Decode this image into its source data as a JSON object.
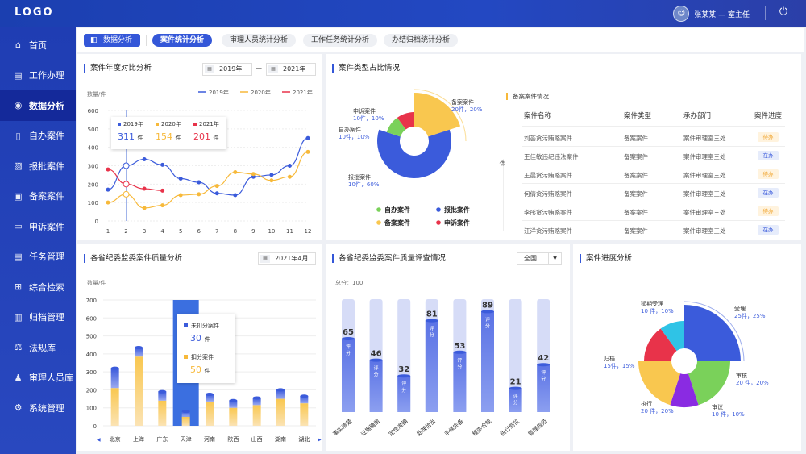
{
  "header": {
    "logo": "LOGO",
    "user_name": "张某某 — 室主任",
    "avatar_icon": "user-avatar"
  },
  "nav": [
    {
      "label": "首页",
      "icon": "home-icon",
      "glyph": "⌂"
    },
    {
      "label": "工作办理",
      "icon": "briefcase-icon",
      "glyph": "▤"
    },
    {
      "label": "数据分析",
      "icon": "chart-icon",
      "glyph": "◉",
      "active": true
    },
    {
      "label": "自办案件",
      "icon": "clipboard-icon",
      "glyph": "▯"
    },
    {
      "label": "报批案件",
      "icon": "document-icon",
      "glyph": "▧"
    },
    {
      "label": "备案案件",
      "icon": "person-card-icon",
      "glyph": "▣"
    },
    {
      "label": "申诉案件",
      "icon": "chat-icon",
      "glyph": "▭"
    },
    {
      "label": "任务管理",
      "icon": "list-icon",
      "glyph": "▤"
    },
    {
      "label": "综合检索",
      "icon": "grid-icon",
      "glyph": "⊞"
    },
    {
      "label": "归档管理",
      "icon": "archive-icon",
      "glyph": "▥"
    },
    {
      "label": "法规库",
      "icon": "scale-icon",
      "glyph": "⚖"
    },
    {
      "label": "审理人员库",
      "icon": "people-icon",
      "glyph": "♟"
    },
    {
      "label": "系统管理",
      "icon": "gear-icon",
      "glyph": "⚙"
    }
  ],
  "tabs": {
    "main": "数据分析",
    "items": [
      "案件统计分析",
      "审理人员统计分析",
      "工作任务统计分析",
      "办结归档统计分析"
    ]
  },
  "panel1": {
    "title": "案件年度对比分析",
    "from": "2019年",
    "dash": "—",
    "to": "2021年",
    "unit": "数量/件",
    "legend": [
      "2019年",
      "2020年",
      "2021年"
    ],
    "tooltip": {
      "items": [
        {
          "year": "2019年",
          "value": "311",
          "unit": "件"
        },
        {
          "year": "2020年",
          "value": "154",
          "unit": "件"
        },
        {
          "year": "2021年",
          "value": "201",
          "unit": "件"
        }
      ]
    },
    "colors": [
      "#3b5bdb",
      "#f7b93a",
      "#e8334a"
    ]
  },
  "panel2": {
    "title": "案件类型占比情况",
    "table_title": "备案案件情况",
    "headers": [
      "案件名称",
      "案件类型",
      "承办部门",
      "案件进度"
    ],
    "rows": [
      {
        "name": "刘荟贪污贿赂案件",
        "type": "备案案件",
        "dept": "案件审理室三处",
        "status": "待办"
      },
      {
        "name": "王佳敏违纪违法案件",
        "type": "备案案件",
        "dept": "案件审理室三处",
        "status": "在办"
      },
      {
        "name": "王晨贪污贿赂案件",
        "type": "备案案件",
        "dept": "案件审理室三处",
        "status": "待办"
      },
      {
        "name": "何倩贪污贿赂案件",
        "type": "备案案件",
        "dept": "案件审理室三处",
        "status": "在办"
      },
      {
        "name": "李彤贪污贿赂案件",
        "type": "备案案件",
        "dept": "案件审理室三处",
        "status": "待办"
      },
      {
        "name": "汪洋贪污贿赂案件",
        "type": "备案案件",
        "dept": "案件审理室三处",
        "status": "在办"
      }
    ],
    "legend": [
      "自办案件",
      "报批案件",
      "备案案件",
      "申诉案件"
    ],
    "labels": [
      {
        "name": "备案案件",
        "value": "20件，20%"
      },
      {
        "name": "申诉案件",
        "value": "10件，10%"
      },
      {
        "name": "自办案件",
        "value": "10件，10%"
      },
      {
        "name": "报批案件",
        "value": "10件，60%"
      }
    ]
  },
  "panel3": {
    "title": "各省纪委监委案件质量分析",
    "date": "2021年4月",
    "unit": "数量/件",
    "tooltip": {
      "a": "未扣分案件",
      "a_val": "30",
      "b": "扣分案件",
      "b_val": "50",
      "unit": "件"
    }
  },
  "panel4": {
    "title": "各省纪委监委案件质量评查情况",
    "select": "全国",
    "total": "总分：100",
    "tag": "评分"
  },
  "panel5": {
    "title": "案件进度分析",
    "labels": [
      {
        "name": "受理",
        "value": "25件，25%"
      },
      {
        "name": "审核",
        "value": "20 件，20%"
      },
      {
        "name": "审议",
        "value": "10 件，10%"
      },
      {
        "name": "执行",
        "value": "20 件，20%"
      },
      {
        "name": "归档",
        "value": "15件，15%"
      },
      {
        "name": "延期受理",
        "value": "10 件，10%"
      }
    ]
  },
  "chart_data": [
    {
      "type": "line",
      "title": "案件年度对比分析",
      "ylabel": "数量/件",
      "x": [
        1,
        2,
        3,
        4,
        5,
        6,
        7,
        8,
        9,
        10,
        11,
        12
      ],
      "ylim": [
        0,
        600
      ],
      "yticks": [
        0,
        100,
        200,
        300,
        400,
        500,
        600
      ],
      "series": [
        {
          "name": "2019年",
          "values": [
            170,
            300,
            335,
            305,
            230,
            210,
            150,
            140,
            240,
            250,
            300,
            450
          ]
        },
        {
          "name": "2020年",
          "values": [
            100,
            145,
            70,
            85,
            140,
            145,
            190,
            265,
            255,
            220,
            240,
            375
          ]
        },
        {
          "name": "2021年",
          "values": [
            280,
            200,
            175,
            165
          ]
        }
      ]
    },
    {
      "type": "pie",
      "title": "案件类型占比情况",
      "categories": [
        "备案案件",
        "报批案件",
        "自办案件",
        "申诉案件"
      ],
      "values": [
        20,
        60,
        10,
        10
      ]
    },
    {
      "type": "bar",
      "title": "各省纪委监委案件质量分析",
      "ylabel": "数量/件",
      "categories": [
        "北京",
        "上海",
        "广东",
        "天津",
        "河南",
        "陕西",
        "山西",
        "湖南",
        "湖北"
      ],
      "ylim": [
        0,
        700
      ],
      "yticks": [
        0,
        100,
        200,
        300,
        400,
        500,
        600,
        700
      ],
      "series": [
        {
          "name": "未扣分案件",
          "values": [
            110,
            50,
            50,
            30,
            40,
            40,
            40,
            50,
            40
          ]
        },
        {
          "name": "扣分案件",
          "values": [
            210,
            385,
            140,
            50,
            135,
            100,
            115,
            150,
            125
          ]
        }
      ]
    },
    {
      "type": "bar",
      "title": "各省纪委监委案件质量评查情况",
      "categories": [
        "事实清楚",
        "证据确凿",
        "定性准确",
        "处理恰当",
        "手续完备",
        "程序合规",
        "执行到位",
        "管理规范"
      ],
      "values": [
        65,
        46,
        32,
        81,
        53,
        89,
        21,
        42
      ],
      "ylim": [
        0,
        100
      ]
    },
    {
      "type": "pie",
      "title": "案件进度分析",
      "categories": [
        "受理",
        "审核",
        "审议",
        "执行",
        "归档",
        "延期受理"
      ],
      "values": [
        25,
        20,
        10,
        20,
        15,
        10
      ]
    }
  ]
}
